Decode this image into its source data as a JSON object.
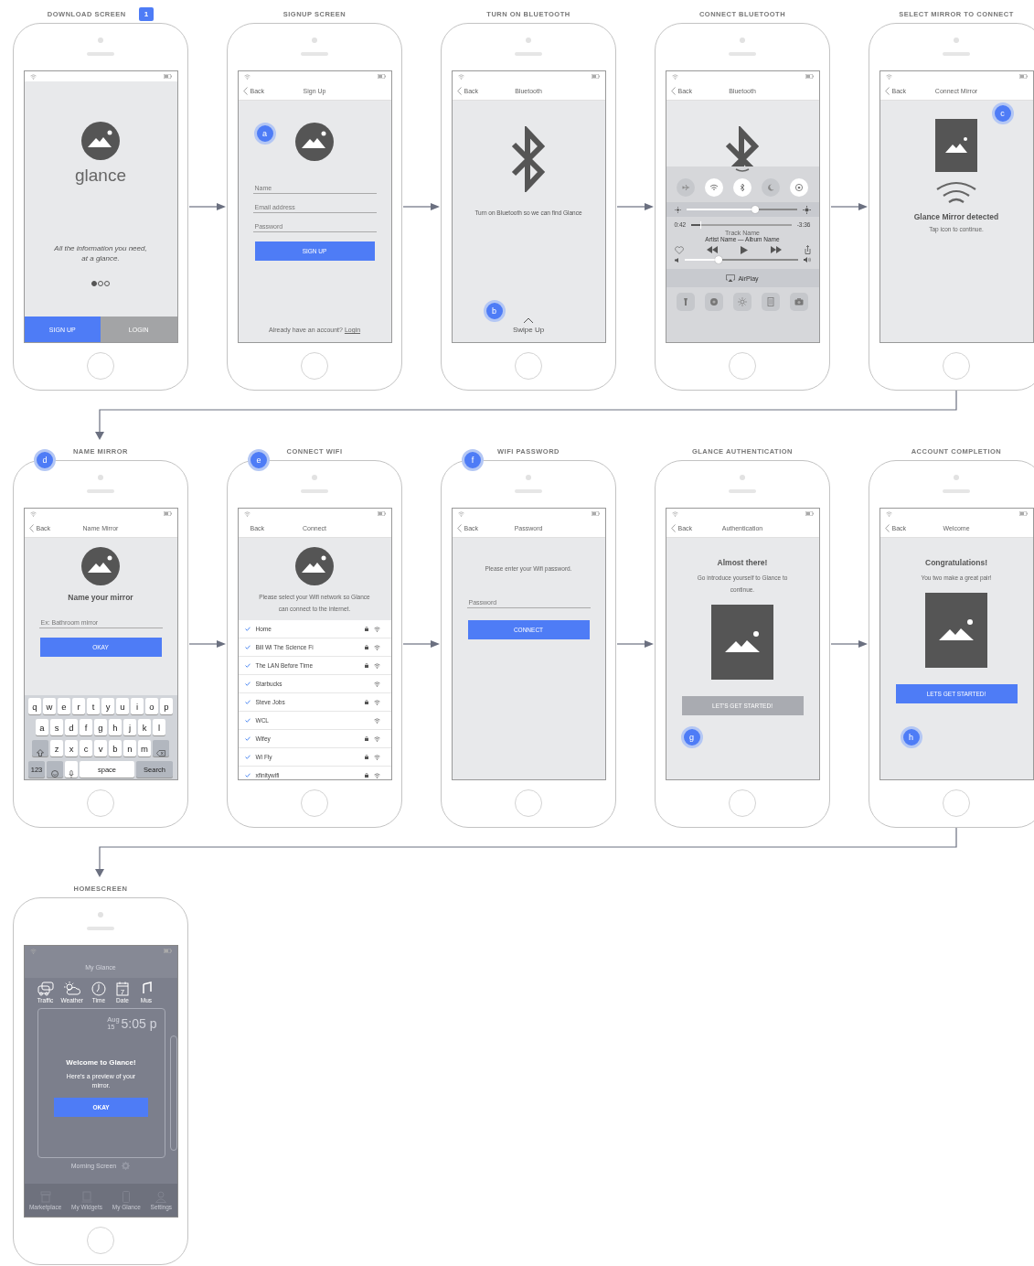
{
  "flow": [
    {
      "screens": [
        {
          "kind": "download",
          "title": "DOWNLOAD SCREEN",
          "badge": "1",
          "app_name": "glance",
          "tagline": "All the information you need, at a glance.",
          "pages": [
            {
              "selected": true
            },
            {
              "selected": false
            },
            {
              "selected": false
            }
          ],
          "buttons": [
            {
              "label": "SIGN UP",
              "selected": true
            },
            {
              "label": "LOGIN",
              "selected": false
            }
          ]
        },
        {
          "kind": "signup",
          "title": "SIGNUP SCREEN",
          "nav": {
            "back": "Back",
            "chevron": true,
            "title": "Sign Up"
          },
          "marker": "a",
          "fields": [
            {
              "placeholder": "Name"
            },
            {
              "placeholder": "Email address"
            },
            {
              "placeholder": "Password"
            }
          ],
          "button": {
            "label": "SIGN UP",
            "disabled": false
          },
          "footer": {
            "text": "Already have an account?",
            "link": "Login"
          }
        },
        {
          "kind": "bluetooth",
          "title": "TURN ON BLUETOOTH",
          "nav": {
            "back": "Back",
            "chevron": true,
            "title": "Bluetooth"
          },
          "message": "Turn on Bluetooth so we can find Glance",
          "marker": "b",
          "hint": "Swipe Up"
        },
        {
          "kind": "control_center",
          "title": "CONNECT BLUETOOTH",
          "nav": {
            "back": "Back",
            "chevron": true,
            "title": "Bluetooth"
          },
          "toggles": [
            {
              "kind": "airplane",
              "on": false
            },
            {
              "kind": "wifi",
              "on": true
            },
            {
              "kind": "bluetooth",
              "on": true
            },
            {
              "kind": "moon",
              "on": false
            },
            {
              "kind": "rotation",
              "on": true
            }
          ],
          "brightness": {
            "level": 0.62
          },
          "elapsed": "0:42",
          "progress": {
            "level": 0.09
          },
          "remaining": "-3:36",
          "track": "Track Name",
          "artist": "Artist Name — Album Name",
          "volume": {
            "level": 0.3
          },
          "airplay": "AirPlay",
          "tools": [
            {
              "kind": "flashlight"
            },
            {
              "kind": "timer"
            },
            {
              "kind": "brightness"
            },
            {
              "kind": "calculator"
            },
            {
              "kind": "camera"
            }
          ]
        },
        {
          "kind": "connect_mirror",
          "title": "SELECT MIRROR TO CONNECT",
          "nav": {
            "back": "Back",
            "chevron": true,
            "title": "Connect Mirror"
          },
          "marker": "c",
          "heading": "Glance Mirror detected",
          "message": "Tap icon to continue."
        }
      ]
    },
    {
      "screens": [
        {
          "kind": "name_mirror",
          "title": "NAME MIRROR",
          "step": "d",
          "nav": {
            "back": "Back",
            "chevron": true,
            "title": "Name Mirror"
          },
          "heading": "Name your mirror",
          "field": {
            "placeholder": "Ex: Bathroom mirror"
          },
          "button": {
            "label": "OKAY",
            "disabled": false
          },
          "keyboard": {
            "rows": [
              [
                "q",
                "w",
                "e",
                "r",
                "t",
                "y",
                "u",
                "i",
                "o",
                "p"
              ],
              [
                "a",
                "s",
                "d",
                "f",
                "g",
                "h",
                "j",
                "k",
                "l"
              ],
              [
                "z",
                "x",
                "c",
                "v",
                "b",
                "n",
                "m"
              ]
            ],
            "numbers": "123",
            "space": "space",
            "action": "Search"
          }
        },
        {
          "kind": "connect_wifi",
          "title": "CONNECT WIFI",
          "step": "e",
          "nav": {
            "back": "Back",
            "chevron": false,
            "title": "Connect"
          },
          "message": "Please select your Wifi network so Glance can connect to the internet.",
          "networks": [
            {
              "name": "Home",
              "checked": true,
              "secured": true
            },
            {
              "name": "Bill Wi The Science Fi",
              "checked": true,
              "secured": true
            },
            {
              "name": "The LAN Before Time",
              "checked": true,
              "secured": true
            },
            {
              "name": "Starbucks",
              "checked": true,
              "secured": false
            },
            {
              "name": "Steve Jobs",
              "checked": true,
              "secured": true
            },
            {
              "name": "WCL",
              "checked": true,
              "secured": false
            },
            {
              "name": "Wifey",
              "checked": true,
              "secured": true
            },
            {
              "name": "Wi Fly",
              "checked": true,
              "secured": true
            },
            {
              "name": "xfinitywifi",
              "checked": true,
              "secured": true
            }
          ]
        },
        {
          "kind": "wifi_password",
          "title": "WIFI PASSWORD",
          "step": "f",
          "nav": {
            "back": "Back",
            "chevron": true,
            "title": "Password"
          },
          "message": "Please enter your Wifi password.",
          "field": {
            "placeholder": "Password"
          },
          "button": {
            "label": "CONNECT",
            "disabled": false
          }
        },
        {
          "kind": "welcome",
          "title": "GLANCE AUTHENTICATION",
          "nav": {
            "back": "Back",
            "chevron": true,
            "title": "Authentication"
          },
          "heading": "Almost there!",
          "message": "Go introduce yourself to Glance to continue.",
          "button": {
            "label": "LET'S GET STARTED!",
            "disabled": true
          },
          "marker": "g"
        },
        {
          "kind": "welcome",
          "title": "ACCOUNT COMPLETION",
          "nav": {
            "back": "Back",
            "chevron": true,
            "title": "Welcome"
          },
          "heading": "Congratulations!",
          "message": "You two make a great pair!",
          "button": {
            "label": "LETS GET STARTED!",
            "disabled": false
          },
          "marker": "h"
        }
      ]
    },
    {
      "screens": [
        {
          "kind": "home",
          "title": "HOMESCREEN",
          "nav_title": "My Glance",
          "widgets": [
            {
              "kind": "traffic",
              "label": "Traffic"
            },
            {
              "kind": "weather",
              "label": "Weather"
            },
            {
              "kind": "time",
              "label": "Time"
            },
            {
              "kind": "date",
              "label": "Date",
              "value": "7"
            },
            {
              "kind": "music",
              "label": "Mus"
            }
          ],
          "clock": {
            "month": "Aug",
            "day": "15",
            "time": "5:05 p"
          },
          "dialog": {
            "title": "Welcome to Glance!",
            "message": "Here's a preview of your mirror.",
            "button": "OKAY"
          },
          "screen_name": "Morning Screen",
          "tabs": [
            {
              "kind": "store",
              "label": "Marketplace"
            },
            {
              "kind": "widgets",
              "label": "My Widgets"
            },
            {
              "kind": "phone",
              "label": "My Glance"
            },
            {
              "kind": "person",
              "label": "Settings"
            }
          ]
        }
      ]
    }
  ]
}
